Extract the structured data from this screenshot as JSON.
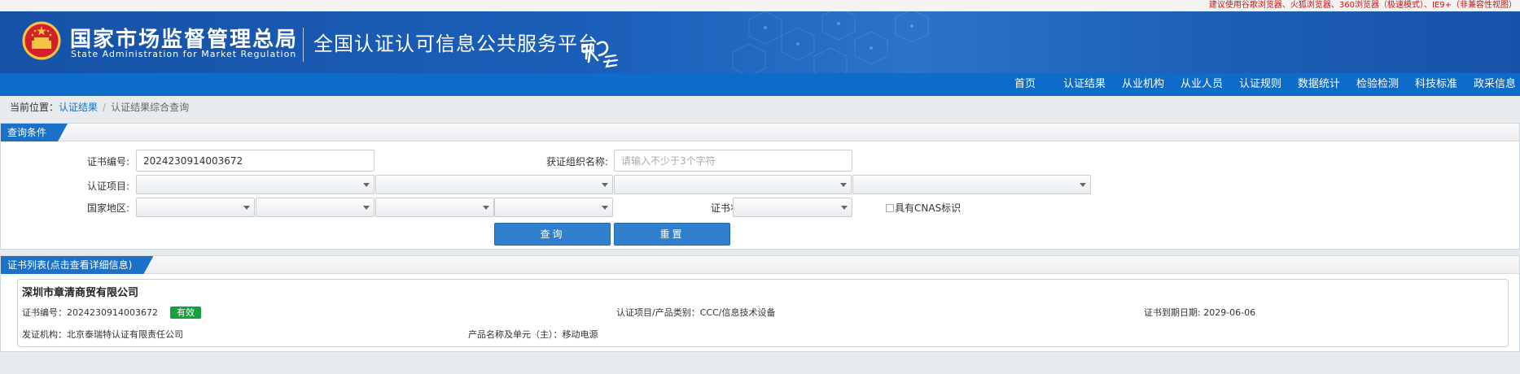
{
  "topbar": {
    "notice": "建议使用谷歌浏览器、火狐浏览器、360浏览器（极速模式）、IE9+（非兼容性视图）"
  },
  "header": {
    "org_name_cn": "国家市场监督管理总局",
    "org_name_en": "State Administration  for  Market Regulation",
    "platform_title": "全国认证认可信息公共服务平台"
  },
  "nav": {
    "items": [
      {
        "label": "首页"
      },
      {
        "label": "认证结果"
      },
      {
        "label": "从业机构"
      },
      {
        "label": "从业人员"
      },
      {
        "label": "认证规则"
      },
      {
        "label": "数据统计"
      },
      {
        "label": "检验检测"
      },
      {
        "label": "科技标准"
      },
      {
        "label": "政采信息"
      }
    ]
  },
  "breadcrumb": {
    "prefix": "当前位置：",
    "parent": "认证结果",
    "separator": "/",
    "current": "认证结果综合查询"
  },
  "query": {
    "title": "查询条件",
    "cert_no_label": "证书编号:",
    "cert_no_value": "2024230914003672",
    "org_label": "获证组织名称:",
    "org_placeholder": "请输入不少于3个字符",
    "project_label": "认证项目:",
    "region_label": "国家地区:",
    "status_label": "证书状态:",
    "cnas_label": "具有CNAS标识",
    "search_button": "查询",
    "reset_button": "重置"
  },
  "results": {
    "title": "证书列表(点击查看详细信息)",
    "items": [
      {
        "company": "深圳市章清商贸有限公司",
        "cert_no": "证书编号：2024230914003672",
        "status": "有效",
        "project": "认证项目/产品类别：CCC/信息技术设备",
        "expiry": "证书到期日期: 2029-06-06",
        "issuer": "发证机构：北京泰瑞特认证有限责任公司",
        "product": "产品名称及单元（主）：移动电源"
      }
    ]
  },
  "colors": {
    "banner": "#1652a8",
    "nav": "#0f6bc9",
    "button": "#2f7fcd",
    "badge_valid": "#15a03c",
    "notice": "#cc1111"
  }
}
